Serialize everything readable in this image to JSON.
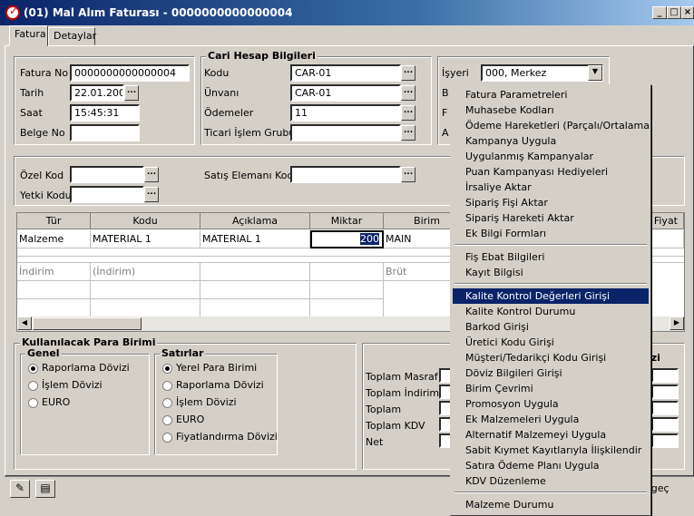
{
  "window": {
    "title": "(01) Mal Alım Faturası - 0000000000000004",
    "min": "_",
    "max": "□",
    "close": "×"
  },
  "tabs": [
    "Fatura",
    "Detaylar"
  ],
  "invoice": {
    "fatura_no_label": "Fatura No",
    "fatura_no": "0000000000000004",
    "tarih_label": "Tarih",
    "tarih": "22.01.2001",
    "saat_label": "Saat",
    "saat": "15:45:31",
    "belge_no_label": "Belge No",
    "belge_no": ""
  },
  "cari": {
    "title": "Cari Hesap Bilgileri",
    "kodu_label": "Kodu",
    "kodu": "CAR-01",
    "unvani_label": "Ünvanı",
    "unvani": "CAR-01",
    "odemeler_label": "Ödemeler",
    "odemeler": "11",
    "ticari_label": "Ticari İşlem Grubu",
    "ticari": ""
  },
  "right": {
    "isyeri_label": "İşyeri",
    "isyeri": "000, Merkez",
    "b_label": "B",
    "f_label": "F",
    "a_label": "A"
  },
  "ozel": {
    "ozel_kod_label": "Özel Kod",
    "ozel_kod": "",
    "yetki_label": "Yetki Kodu",
    "yetki": "",
    "satis_label": "Satış Elemanı Kodu",
    "satis": ""
  },
  "grid": {
    "headers": [
      "Tür",
      "Kodu",
      "Açıklama",
      "Miktar",
      "Birim",
      "m Fiyat"
    ],
    "row1": [
      "Malzeme",
      "MATERIAL 1",
      "MATERIAL 1",
      "200",
      "MAIN"
    ],
    "row2": [
      "İndirim",
      "(İndirim)",
      "",
      "",
      "Brüt"
    ]
  },
  "para": {
    "title": "Kullanılacak Para Birimi",
    "genel_title": "Genel",
    "genel": [
      "Raporlama Dövizi",
      "İşlem Dövizi",
      "EURO"
    ],
    "satirlar_title": "Satırlar",
    "satirlar": [
      "Yerel Para Birimi",
      "Raporlama Dövizi",
      "İşlem Dövizi",
      "EURO",
      "Fiyatlandırma Dövizi"
    ]
  },
  "totals": {
    "labels": [
      "Toplam Masraf",
      "Toplam İndirim",
      "Toplam",
      "Toplam KDV",
      "Net"
    ],
    "dovizi": "izi"
  },
  "bottom": {
    "vazgec": "zgeç"
  },
  "menu": {
    "items_a": [
      "Fatura Parametreleri",
      "Muhasebe Kodları",
      "Ödeme Hareketleri (Parçalı/Ortalama)",
      "Kampanya Uygula",
      "Uygulanmış Kampanyalar",
      "Puan Kampanyası Hediyeleri",
      "İrsaliye Aktar",
      "Sipariş Fişi Aktar",
      "Sipariş Hareketi Aktar",
      "Ek Bilgi Formları"
    ],
    "items_b": [
      "Fiş Ebat Bilgileri",
      "Kayıt Bilgisi"
    ],
    "items_c": [
      "Kalite Kontrol Değerleri Girişi",
      "Kalite Kontrol Durumu",
      "Barkod Girişi",
      "Üretici Kodu Girişi",
      "Müşteri/Tedarikçi Kodu Girişi",
      "Döviz Bilgileri Girişi",
      "Birim Çevrimi",
      "Promosyon Uygula",
      "Ek Malzemeleri Uygula",
      "Alternatif Malzemeyi Uygula",
      "Sabit Kıymet Kayıtlarıyla İlişkilendir",
      "Satıra Ödeme Planı Uygula",
      "KDV Düzenleme"
    ],
    "items_d": [
      "Malzeme Durumu"
    ]
  }
}
